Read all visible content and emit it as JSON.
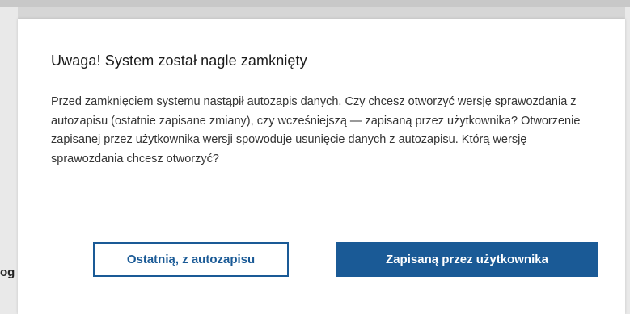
{
  "background": {
    "peek_text": "og"
  },
  "dialog": {
    "title": "Uwaga! System został nagle zamknięty",
    "message": "Przed zamknięciem systemu nastąpił autozapis danych. Czy chcesz otworzyć wersję sprawozdania z autozapisu (ostatnie zapisane zmiany), czy wcześniejszą — zapisaną przez użytkownika? Otworzenie zapisanej przez użytkownika wersji spowoduje usunięcie danych z autozapisu. Którą wersję sprawozdania chcesz otworzyć?",
    "secondary_button_label": "Ostatnią, z autozapisu",
    "primary_button_label": "Zapisaną przez użytkownika"
  },
  "colors": {
    "accent": "#1a5a96",
    "overlay": "#d6d6d6",
    "dialog_background": "#ffffff"
  }
}
